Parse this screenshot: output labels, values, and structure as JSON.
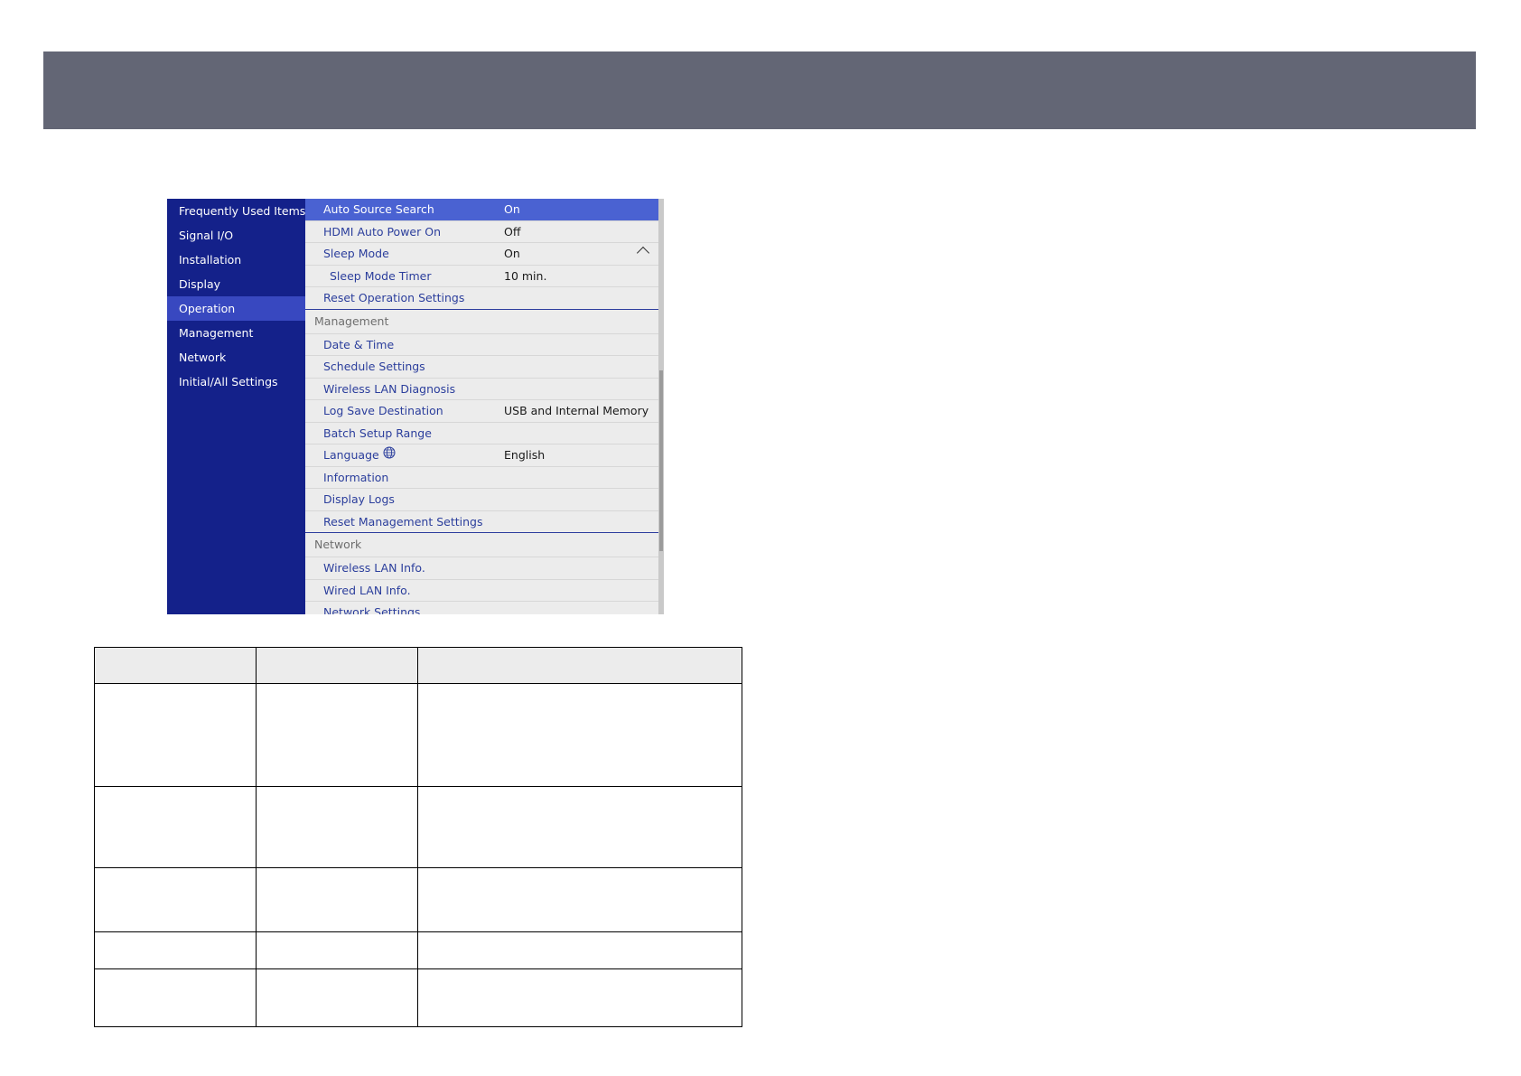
{
  "sidebar": {
    "items": [
      {
        "label": "Frequently Used Items"
      },
      {
        "label": "Signal I/O"
      },
      {
        "label": "Installation"
      },
      {
        "label": "Display"
      },
      {
        "label": "Operation",
        "selected": true
      },
      {
        "label": "Management"
      },
      {
        "label": "Network"
      },
      {
        "label": "Initial/All Settings"
      }
    ]
  },
  "operation": {
    "auto_source_search": {
      "label": "Auto Source Search",
      "value": "On"
    },
    "hdmi_auto_power_on": {
      "label": "HDMI Auto Power On",
      "value": "Off"
    },
    "sleep_mode": {
      "label": "Sleep Mode",
      "value": "On"
    },
    "sleep_mode_timer": {
      "label": "Sleep Mode Timer",
      "value": "10 min."
    },
    "reset": {
      "label": "Reset Operation Settings"
    }
  },
  "management": {
    "header": "Management",
    "date_time": {
      "label": "Date & Time"
    },
    "schedule_settings": {
      "label": "Schedule Settings"
    },
    "wireless_lan_diagnosis": {
      "label": "Wireless LAN Diagnosis"
    },
    "log_save_destination": {
      "label": "Log Save Destination",
      "value": "USB and Internal Memory"
    },
    "batch_setup_range": {
      "label": "Batch Setup Range"
    },
    "language": {
      "label": "Language",
      "value": "English"
    },
    "information": {
      "label": "Information"
    },
    "display_logs": {
      "label": "Display Logs"
    },
    "reset": {
      "label": "Reset Management Settings"
    }
  },
  "network": {
    "header": "Network",
    "wireless_lan_info": {
      "label": "Wireless LAN Info."
    },
    "wired_lan_info": {
      "label": "Wired LAN Info."
    },
    "network_settings": {
      "label": "Network Settings"
    }
  },
  "colors": {
    "header_bar": "#636675",
    "sidebar_bg": "#14218a",
    "sidebar_selected": "#3848c0",
    "row_selected": "#4a62d2",
    "label_text": "#2b3e9c"
  },
  "icons": {
    "language": "globe-icon",
    "sleep_mode": "chevron-up-icon"
  }
}
